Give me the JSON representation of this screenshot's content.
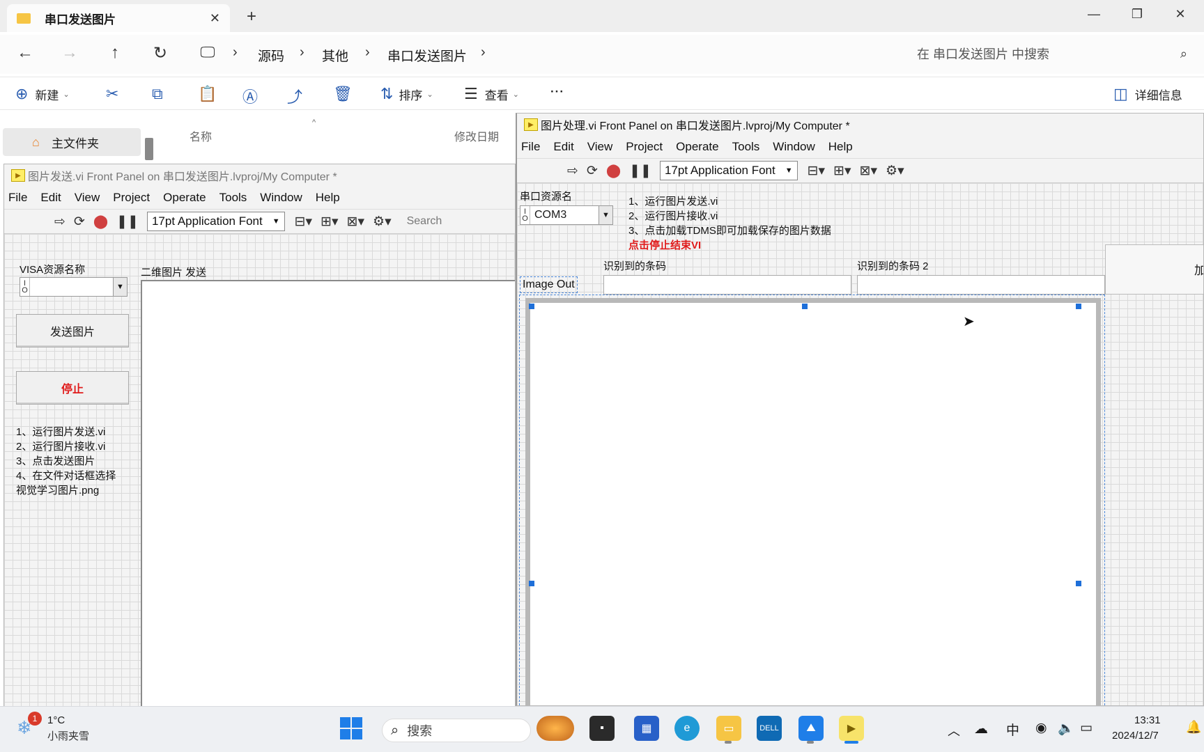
{
  "explorer": {
    "tab_title": "串口发送图片",
    "breadcrumb": [
      "源码",
      "其他",
      "串口发送图片"
    ],
    "search_placeholder": "在 串口发送图片 中搜索",
    "commands": {
      "new": "新建",
      "sort": "排序",
      "view": "查看",
      "more": "···",
      "details": "详细信息"
    },
    "sidebar_home": "主文件夹",
    "columns": {
      "name": "名称",
      "modified": "修改日期"
    }
  },
  "vi_send": {
    "title": "图片发送.vi Front Panel on 串口发送图片.lvproj/My Computer *",
    "menu": [
      "File",
      "Edit",
      "View",
      "Project",
      "Operate",
      "Tools",
      "Window",
      "Help"
    ],
    "font": "17pt Application Font",
    "search": "Search",
    "visa_label": "VISA资源名称",
    "image_label": "二维图片 发送",
    "send_button": "发送图片",
    "stop_button": "停止",
    "instructions": [
      "1、运行图片发送.vi",
      "2、运行图片接收.vi",
      "3、点击发送图片",
      "4、在文件对话框选择",
      "视觉学习图片.png"
    ]
  },
  "vi_process": {
    "title": "图片处理.vi Front Panel on 串口发送图片.lvproj/My Computer *",
    "menu": [
      "File",
      "Edit",
      "View",
      "Project",
      "Operate",
      "Tools",
      "Window",
      "Help"
    ],
    "font": "17pt Application Font",
    "serial_label": "串口资源名",
    "serial_value": "COM3",
    "instructions": [
      "1、运行图片发送.vi",
      "2、运行图片接收.vi",
      "3、点击加载TDMS即可加载保存的图片数据"
    ],
    "stop_note": "点击停止结束VI",
    "barcode_label_1": "识别到的条码",
    "barcode_label_2": "识别到的条码 2",
    "image_out_label": "Image Out",
    "partial_button_text": "加"
  },
  "taskbar": {
    "weather_temp": "1°C",
    "weather_desc": "小雨夹雪",
    "weather_badge": "1",
    "search": "搜索",
    "ime": "中",
    "time": "13:31",
    "date": "2024/12/7"
  },
  "colors": {
    "stop_red": "#e01b1b",
    "selection_blue": "#1e6fd9",
    "folder_yellow": "#f6c544"
  }
}
